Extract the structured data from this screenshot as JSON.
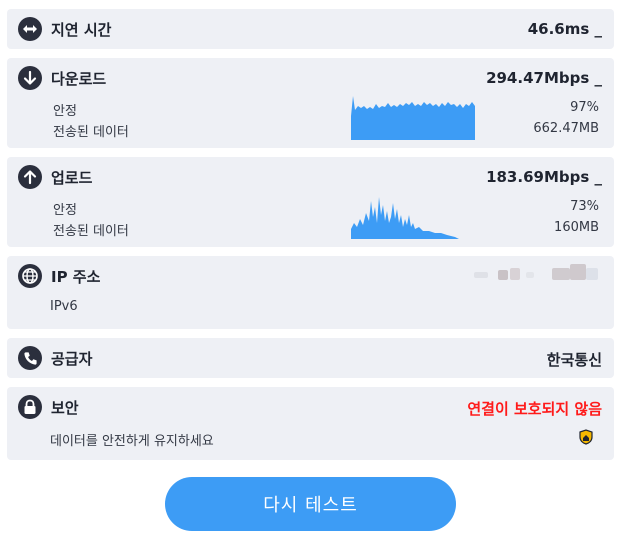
{
  "latency": {
    "icon": "double-arrow-icon",
    "title": "지연 시간",
    "value": "46.6ms _"
  },
  "download": {
    "icon": "arrow-down-circle-icon",
    "title": "다운로드",
    "value": "294.47Mbps _",
    "stability_label": "안정",
    "stability_value": "97%",
    "transferred_label": "전송된 데이터",
    "transferred_value": "662.47MB"
  },
  "upload": {
    "icon": "arrow-up-circle-icon",
    "title": "업로드",
    "value": "183.69Mbps _",
    "stability_label": "안정",
    "stability_value": "73%",
    "transferred_label": "전송된 데이터",
    "transferred_value": "160MB"
  },
  "ip": {
    "icon": "globe-icon",
    "title": "IP 주소",
    "version": "IPv6"
  },
  "provider": {
    "icon": "phone-icon",
    "title": "공급자",
    "value": "한국통신"
  },
  "security": {
    "icon": "lock-icon",
    "title": "보안",
    "status": "연결이 보호되지 않음",
    "hint": "데이터를 안전하게 유지하세요",
    "warning_icon": "shield-warning-icon"
  },
  "retest_button": "다시 테스트",
  "colors": {
    "accent": "#3d9cf5",
    "danger": "#ff1a1a",
    "card": "#eef0f5",
    "icon_bg": "#2b2f3d"
  }
}
